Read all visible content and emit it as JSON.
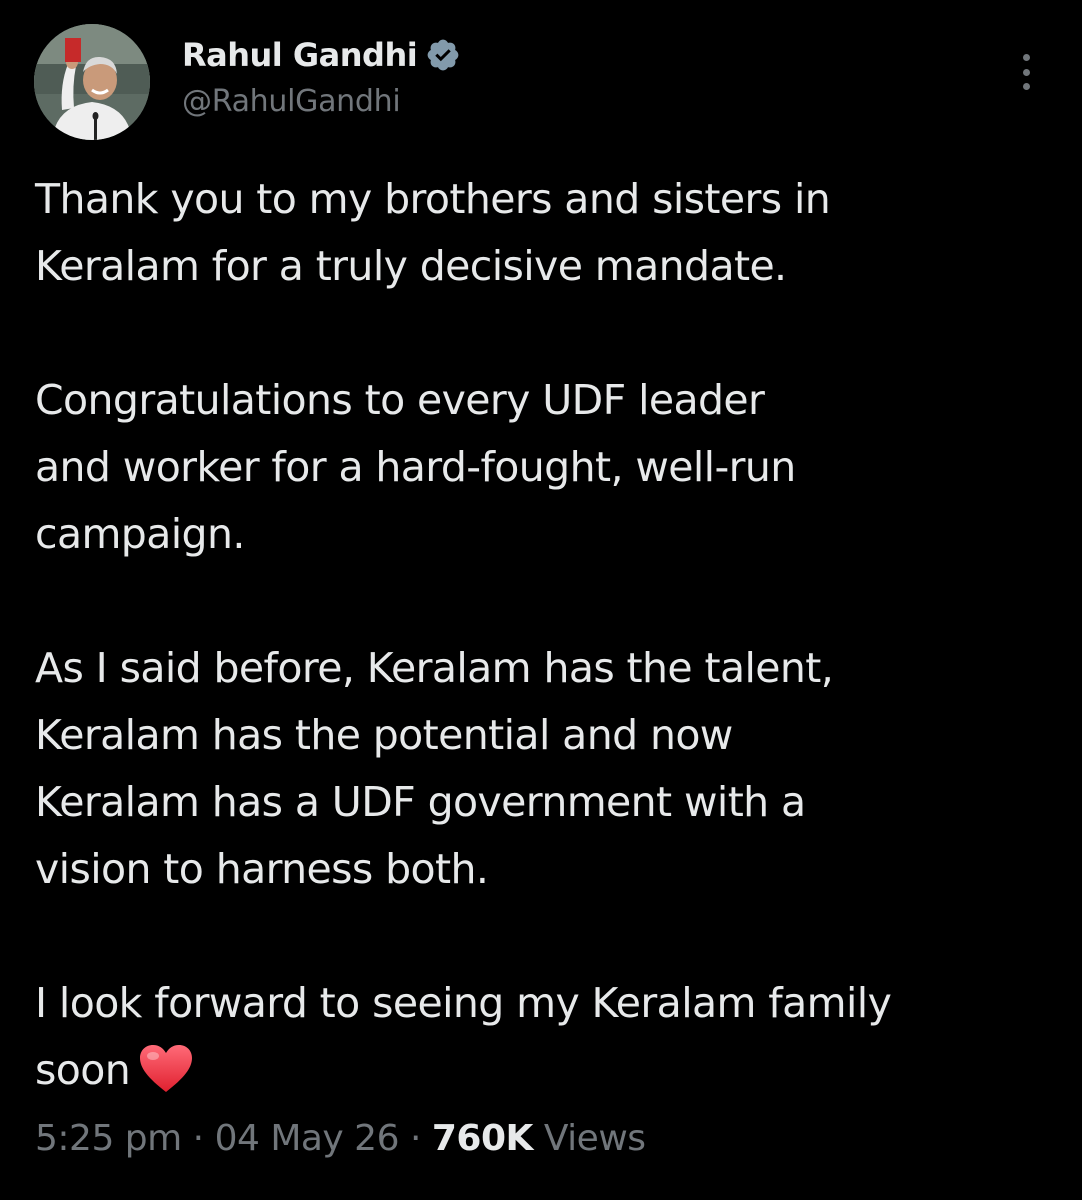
{
  "author": {
    "name": "Rahul Gandhi",
    "handle": "@RahulGandhi",
    "verified_icon": "verified-badge-icon",
    "avatar_icon": "profile-photo"
  },
  "actions": {
    "more_icon": "more-vertical-icon"
  },
  "tweet": {
    "line1": "Thank you to my brothers and sisters in",
    "line2": "Keralam for a truly decisive mandate.",
    "line3": "Congratulations to every UDF leader",
    "line4": "and worker for a hard-fought, well-run",
    "line5": "campaign.",
    "line6": "As I said before, Keralam has the talent,",
    "line7": "Keralam has the potential and now",
    "line8": "Keralam has a UDF government with a",
    "line9": "vision to harness both.",
    "line10": "I look forward to seeing my Keralam family",
    "line11": "soon",
    "emoji_icon": "red-heart-icon"
  },
  "meta": {
    "time": "5:25 pm",
    "separator": " · ",
    "date": "04 May 26",
    "views_count": "760K",
    "views_label": "Views"
  },
  "colors": {
    "background": "#000000",
    "text_primary": "#e7e9ea",
    "text_secondary": "#71767b",
    "verified_badge": "#829aab",
    "heart": "#f0303f"
  }
}
